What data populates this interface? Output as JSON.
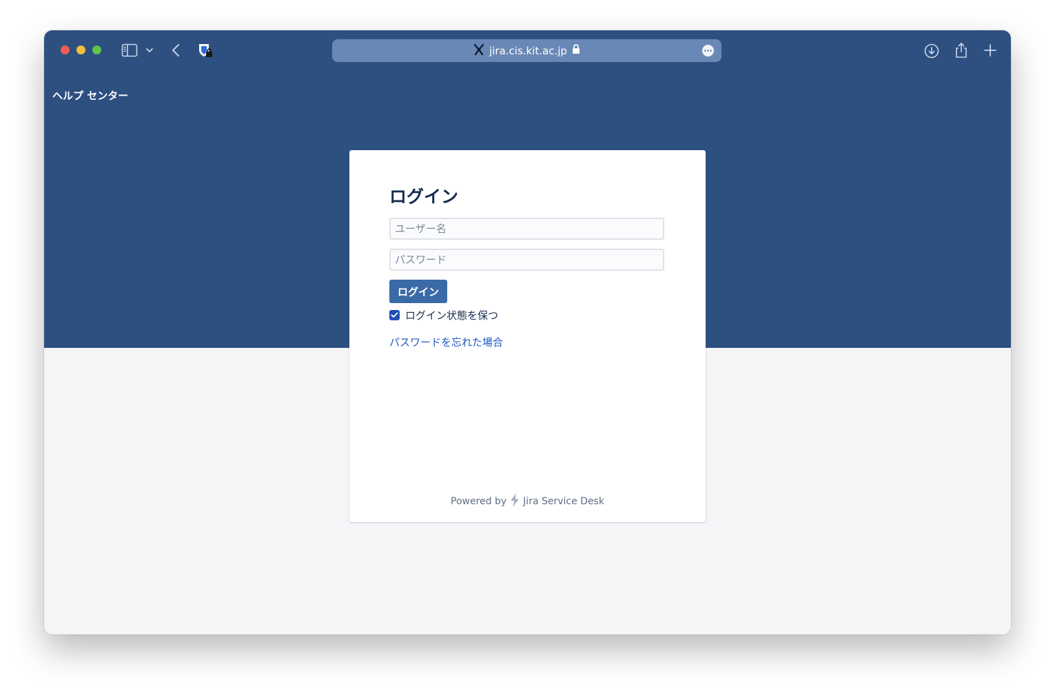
{
  "browser": {
    "url": "jira.cis.kit.ac.jp"
  },
  "header": {
    "help_center": "ヘルプ センター"
  },
  "login": {
    "title": "ログイン",
    "username_placeholder": "ユーザー名",
    "username_value": "",
    "password_placeholder": "パスワード",
    "password_value": "",
    "submit_label": "ログイン",
    "remember_label": "ログイン状態を保つ",
    "remember_checked": true,
    "forgot_link": "パスワードを忘れた場合"
  },
  "footer": {
    "powered_by": "Powered by",
    "product": "Jira Service Desk"
  },
  "colors": {
    "header_bg": "#2d5080",
    "page_bg": "#f4f5f7",
    "primary_button": "#3b6aa8",
    "link": "#1f57c3"
  }
}
